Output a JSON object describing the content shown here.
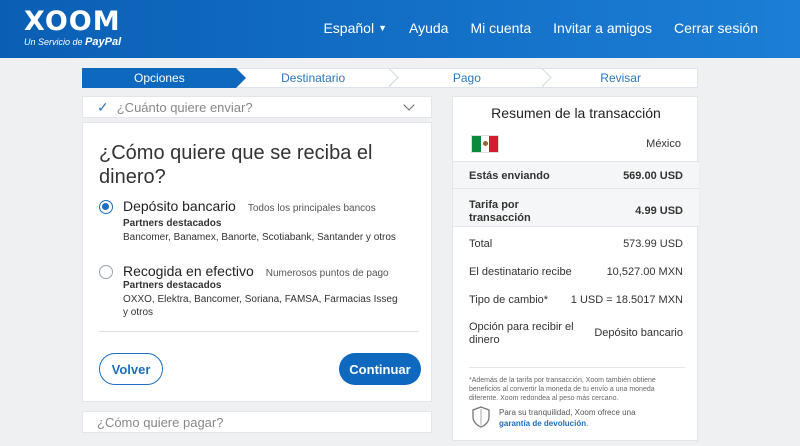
{
  "brand": {
    "name": "XOOM",
    "sub_prefix": "Un Servicio de",
    "sub_brand": "PayPal"
  },
  "nav": {
    "language": "Español",
    "help": "Ayuda",
    "account": "Mi cuenta",
    "invite": "Invitar a amigos",
    "logout": "Cerrar sesión"
  },
  "steps": [
    "Opciones",
    "Destinatario",
    "Pago",
    "Revisar"
  ],
  "amount_section": {
    "label": "¿Cuánto quiere enviar?"
  },
  "receive": {
    "title": "¿Cómo quiere que se reciba el dinero?",
    "options": [
      {
        "label": "Depósito bancario",
        "note": "Todos los principales bancos",
        "partners_label": "Partners destacados",
        "partners": "Bancomer, Banamex, Banorte, Scotiabank, Santander y otros",
        "selected": true
      },
      {
        "label": "Recogida en efectivo",
        "note": "Numerosos puntos de pago",
        "partners_label": "Partners destacados",
        "partners": "OXXO, Elektra, Bancomer, Soriana, FAMSA, Farmacias Isseg y otros",
        "selected": false
      }
    ],
    "back": "Volver",
    "continue": "Continuar"
  },
  "pay_section": {
    "label": "¿Cómo quiere pagar?"
  },
  "summary": {
    "title": "Resumen de la transacción",
    "country": "México",
    "sending_label": "Estás enviando",
    "sending_value": "569.00 USD",
    "fee_label": "Tarifa por transacción",
    "fee_value": "4.99 USD",
    "total_label": "Total",
    "total_value": "573.99 USD",
    "receives_label": "El destinatario recibe",
    "receives_value": "10,527.00 MXN",
    "rate_label": "Tipo de cambio*",
    "rate_value": "1 USD = 18.5017 MXN",
    "method_label": "Opción para recibir el dinero",
    "method_value": "Depósito bancario",
    "footnote": "*Además de la tarifa por transacción, Xoom también obtiene beneficios al convertir la moneda de tu envío a una moneda diferente. Xoom redondea al peso más cercano.",
    "guarantee_text": "Para su tranquilidad, Xoom ofrece una",
    "guarantee_link": "garantía de devolución",
    "guarantee_end": "."
  },
  "colors": {
    "header": "#0a5fb4",
    "accent": "#0e68bd",
    "link": "#1c6fc0"
  }
}
